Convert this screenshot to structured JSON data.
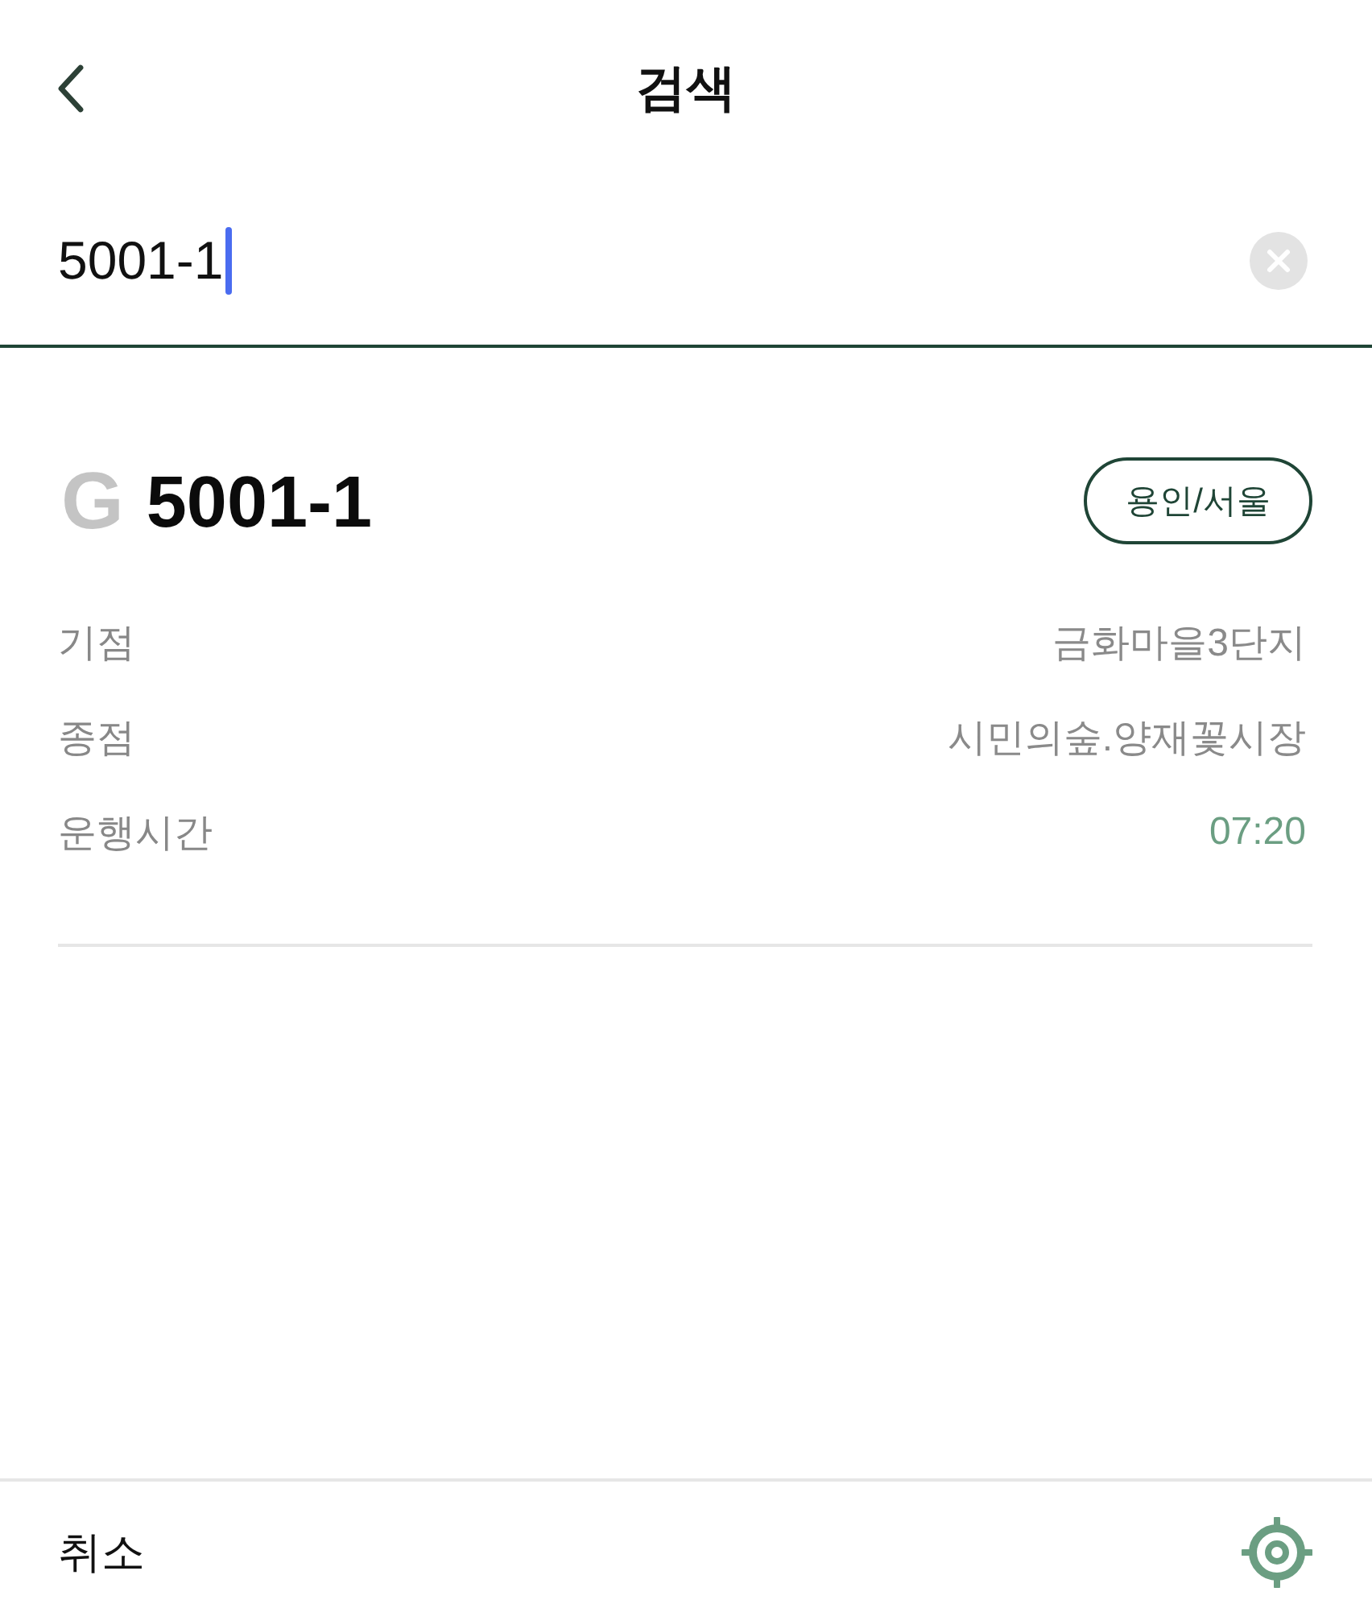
{
  "header": {
    "title": "검색"
  },
  "search": {
    "value": "5001-1"
  },
  "result": {
    "route_type": "G",
    "route_number": "5001-1",
    "region_badge": "용인/서울",
    "details": [
      {
        "label": "기점",
        "value": "금화마을3단지",
        "kind": "text"
      },
      {
        "label": "종점",
        "value": "시민의숲.양재꽃시장",
        "kind": "text"
      },
      {
        "label": "운행시간",
        "value": "07:20",
        "kind": "time"
      }
    ]
  },
  "footer": {
    "cancel": "취소"
  }
}
